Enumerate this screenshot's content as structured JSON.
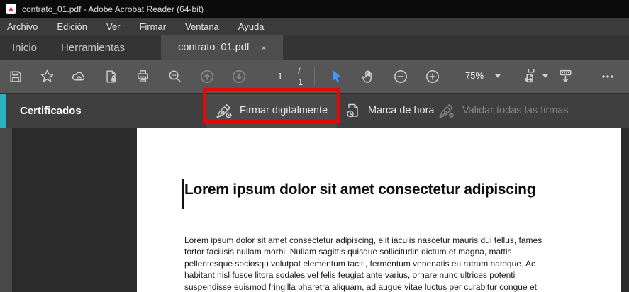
{
  "window": {
    "title": "contrato_01.pdf - Adobe Acrobat Reader (64-bit)"
  },
  "menubar": {
    "items": [
      "Archivo",
      "Edición",
      "Ver",
      "Firmar",
      "Ventana",
      "Ayuda"
    ]
  },
  "tabs": {
    "home": "Inicio",
    "tools": "Herramientas",
    "document": "contrato_01.pdf",
    "close_glyph": "×"
  },
  "toolbar": {
    "page_current": "1",
    "page_total": "/ 1",
    "zoom_level": "75%"
  },
  "panel": {
    "title": "Certificados",
    "sign_label": "Firmar digitalmente",
    "timestamp_label": "Marca de hora",
    "validate_label": "Validar todas las firmas"
  },
  "document": {
    "heading": "Lorem ipsum dolor sit amet consectetur adipiscing",
    "body": "Lorem ipsum dolor sit amet consectetur adipiscing, elit iaculis nascetur mauris dui tellus, fames\ntortor facilisis nullam morbi. Nullam sagittis quisque sollicitudin dictum et magna, mattis\npellentesque sociosqu volutpat elementum taciti, fermentum venenatis eu rutrum natoque. Ac\nhabitant nisl fusce litora sodales vel felis feugiat ante varius, ornare nunc ultrices potenti\nsuspendisse euismod fringilla pharetra aliquam, ad augue vitae luctus per curabitur congue et"
  },
  "colors": {
    "panel_accent_teal": "#29b3c0",
    "highlight_red": "#e60808",
    "selection_blue": "#3f9bff",
    "titlebar_black": "#0b0b0b",
    "toolbar_gray": "#565656",
    "page_white": "#ffffff"
  },
  "icons": {
    "titlebar": "adobe-reader-logo",
    "toolbar": [
      "save",
      "star-favorites",
      "cloud-upload",
      "page-lock-protect",
      "print",
      "search",
      "previous-page",
      "next-page",
      "selection-arrow",
      "hand-pan",
      "zoom-out",
      "zoom-in",
      "zoom-dropdown",
      "fit-width-page",
      "scrolling-mode",
      "more-tools-ellipsis"
    ],
    "panel": [
      "sign-pen-nib",
      "timestamp-page-clock",
      "validate-pen-check"
    ],
    "tab": "close-x"
  }
}
